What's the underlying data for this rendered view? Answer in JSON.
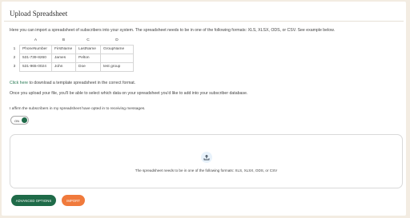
{
  "page": {
    "title": "Upload Spreadsheet",
    "intro": "Here you can import a spreadsheet of subscribers into your system. The spreadsheet needs to be in one of the following formats: XLS, XLSX, ODS, or CSV. See example below."
  },
  "sample_table": {
    "columns": [
      "A",
      "B",
      "C",
      "D"
    ],
    "rows": [
      {
        "num": "1",
        "cells": [
          "PhoneNumber",
          "FirstName",
          "LastName",
          "GroupName"
        ]
      },
      {
        "num": "2",
        "cells": [
          "531-739-8260",
          "James",
          "Pelton",
          ""
        ]
      },
      {
        "num": "3",
        "cells": [
          "531-965-0024",
          "John",
          "Doe",
          "test group"
        ]
      }
    ]
  },
  "template": {
    "link": "Click here",
    "rest": " to download a template spreadsheet in the correct format."
  },
  "upload_info": "Once you upload your file, you'll be able to select which data on your spreadsheet you'd like to add into your subscriber database.",
  "affirm": {
    "label": "I affirm the subscribers in my spreadsheet have opted in to receiving messages.",
    "toggle_text": "ON",
    "checked": true
  },
  "dropzone": {
    "icon": "upload-icon",
    "text": "The spreadsheet needs to be in one of the following formats: XLS, XLSX, ODS, or CSV"
  },
  "buttons": {
    "advanced": "ADVANCED OPTIONS",
    "import": "IMPORT"
  },
  "colors": {
    "brand_green": "#1f6b49",
    "accent_orange": "#f07a3c",
    "background": "#f3ece2"
  }
}
